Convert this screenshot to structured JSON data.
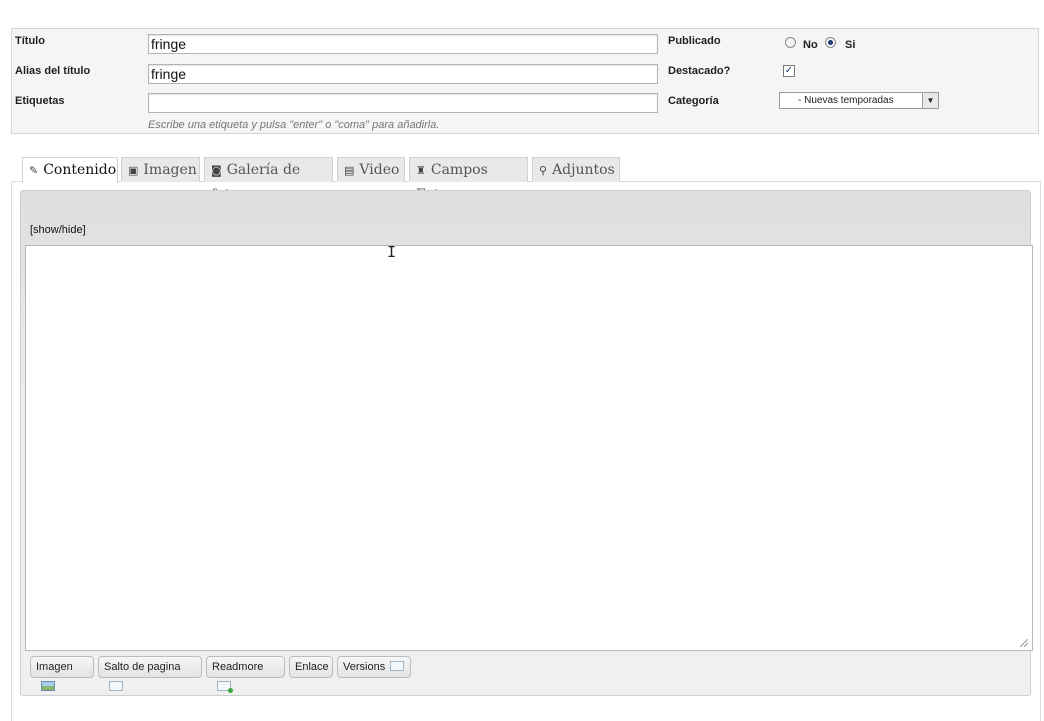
{
  "form": {
    "titulo_label": "Título",
    "titulo_value": "fringe",
    "alias_label": "Alias del título",
    "alias_value": "fringe",
    "etiquetas_label": "Etiquetas",
    "etiquetas_value": "",
    "etiquetas_hint": "Escribe una etiqueta y pulsa \"enter\" o \"coma\" para añadirla.",
    "publicado_label": "Publicado",
    "publicado_no": "No",
    "publicado_si": "Si",
    "publicado_selected": "Si",
    "destacado_label": "Destacado?",
    "destacado_checked": true,
    "categoria_label": "Categoría",
    "categoria_value": "- Nuevas temporadas"
  },
  "tabs": [
    {
      "label": "Contenido",
      "icon": "edit-icon",
      "active": true
    },
    {
      "label": "Imagen",
      "icon": "image-icon",
      "active": false
    },
    {
      "label": "Galería de fotos",
      "icon": "camera-icon",
      "active": false
    },
    {
      "label": "Video",
      "icon": "film-icon",
      "active": false
    },
    {
      "label": "Campos Extra",
      "icon": "puzzle-icon",
      "active": false
    },
    {
      "label": "Adjuntos",
      "icon": "paperclip-icon",
      "active": false
    }
  ],
  "editor": {
    "toggle_label": "[show/hide]",
    "content": "",
    "buttons": [
      {
        "label": "Imagen",
        "icon": "picture-icon"
      },
      {
        "label": "Salto de pagina",
        "icon": "pagebreak-icon"
      },
      {
        "label": "Readmore",
        "icon": "readmore-icon"
      },
      {
        "label": "Enlace",
        "icon": ""
      },
      {
        "label": "Versions",
        "icon": "versions-icon"
      }
    ]
  }
}
